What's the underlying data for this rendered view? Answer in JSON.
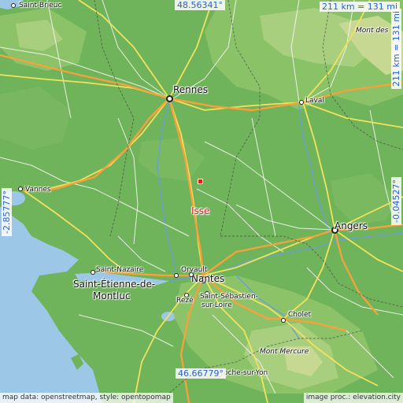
{
  "map": {
    "poi": {
      "name": "Isse"
    },
    "cities": {
      "rennes": "Rennes",
      "nantes": "Nantes",
      "angers": "Angers",
      "laval": "Laval",
      "vannes": "Vannes",
      "saint_brieuc": "Saint-Brieuc",
      "saint_nazaire": "Saint-Nazaire",
      "saint_etienne_1": "Saint-Étienne-de-",
      "saint_etienne_2": "Montluc",
      "orvault": "Orvault",
      "reze": "Rezé",
      "saint_sebastien_1": "Saint-Sébastien-",
      "saint_sebastien_2": "sur-Loire",
      "cholet": "Cholet",
      "mont_mercure": "Mont Mercure",
      "roche_sur_yon": "oche-sur-Yon",
      "mont_des": "Mont des"
    },
    "coordinates": {
      "top_lat": "48.56341°",
      "bottom_lat": "46.66779°",
      "left_lon": "-2.85777°",
      "right_lon": "-0.04527°"
    },
    "scale": {
      "horizontal": "211 km = 131 mi",
      "vertical": "211 km = 131 mi"
    },
    "credits": {
      "left": "map data: openstreetmap, style: opentopomap",
      "right": "image proc.: elevation.city"
    },
    "colors": {
      "sea": "#9cc7e6",
      "lowland": "#6fb35a",
      "upland": "#a8cf7e",
      "highland": "#d6dfa0",
      "motorway": "#f4a23c",
      "road": "#f3e25b",
      "poi": "#e02020",
      "coord_text": "#2b5fd8"
    }
  }
}
